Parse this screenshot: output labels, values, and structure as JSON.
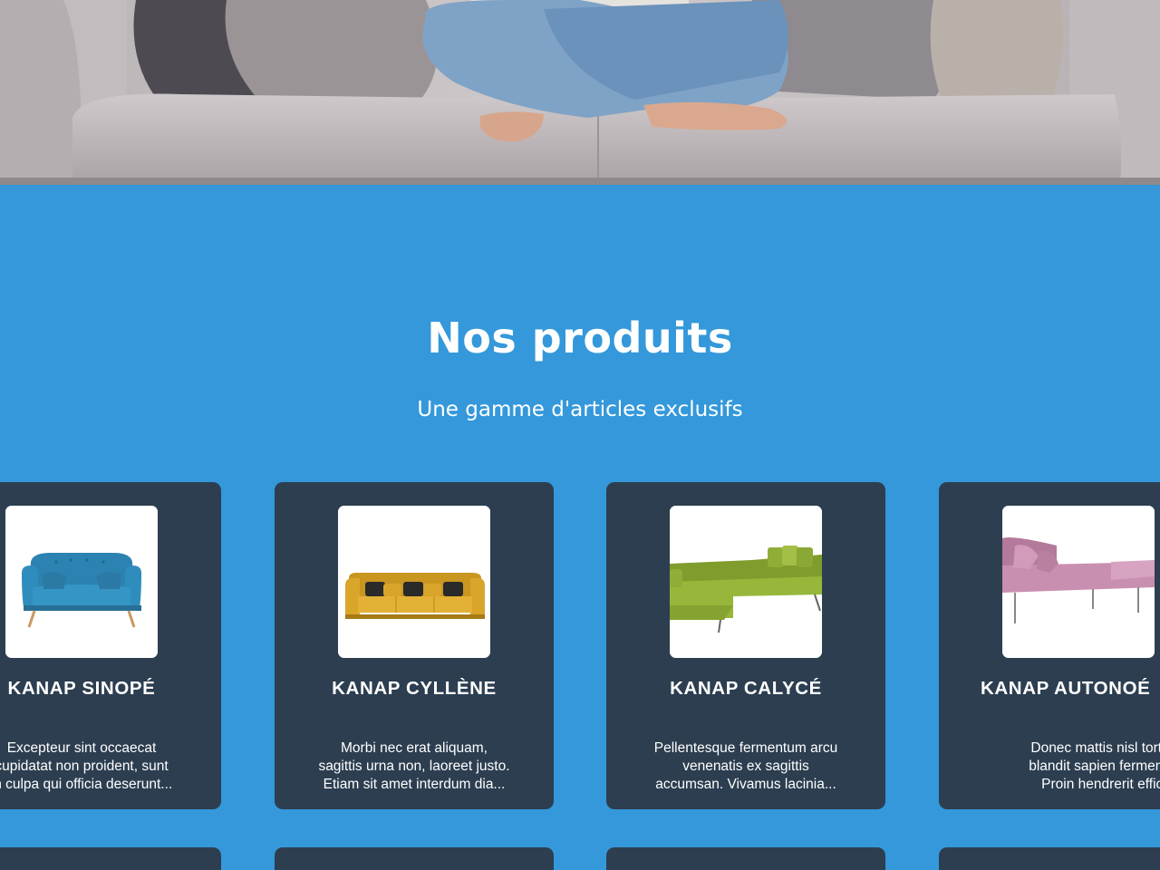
{
  "hero": {
    "image": "woman-sitting-on-grey-sofa-photo"
  },
  "products_section": {
    "title": "Nos produits",
    "subtitle": "Une gamme d'articles exclusifs",
    "background_color": "#3498db",
    "card_color": "#2c3e50",
    "products": [
      {
        "name": "KANAP SINOPÉ",
        "desc_lines": [
          "Excepteur sint occaecat",
          "cupidatat non proident, sunt",
          "in culpa qui officia deserunt..."
        ],
        "image": "blue-armchair-sofa",
        "color": "#2e86b3"
      },
      {
        "name": "KANAP CYLLÈNE",
        "desc_lines": [
          "Morbi nec erat aliquam,",
          "sagittis urna non, laoreet justo.",
          "Etiam sit amet interdum dia..."
        ],
        "image": "yellow-sofa",
        "color": "#d9a52a"
      },
      {
        "name": "KANAP CALYCÉ",
        "desc_lines": [
          "Pellentesque fermentum arcu",
          "venenatis ex sagittis",
          "accumsan. Vivamus lacinia..."
        ],
        "image": "green-corner-sofa",
        "color": "#8fae33"
      },
      {
        "name": "KANAP AUTONOÉ",
        "desc_lines": [
          "Donec mattis nisl tortor, nec",
          "blandit sapien fermentum at.",
          "Proin hendrerit efficitur..."
        ],
        "image": "pink-sofa-bed",
        "color": "#c98fb0"
      }
    ]
  }
}
